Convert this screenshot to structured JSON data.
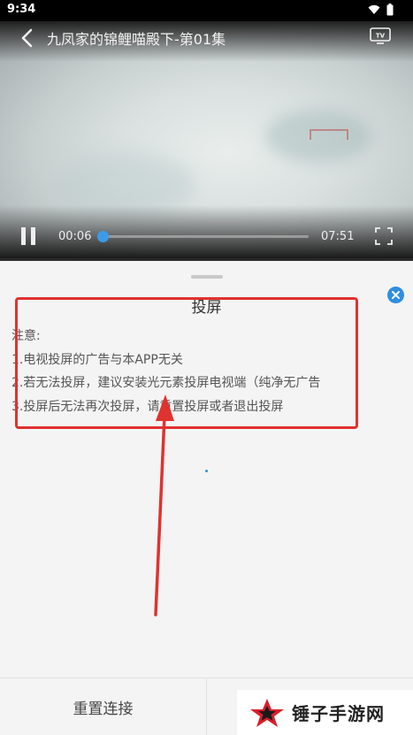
{
  "status_bar": {
    "time": "9:34",
    "icons": [
      "wifi-icon",
      "battery-icon"
    ]
  },
  "player": {
    "title": "九凤家的锦鲤喵殿下-第01集",
    "current_time": "00:06",
    "total_time": "07:51",
    "progress_fraction": 0.013,
    "accent_color": "#3c9be8",
    "icons": [
      "back-icon",
      "tv-cast-icon",
      "pause-icon",
      "fullscreen-icon"
    ]
  },
  "cast_sheet": {
    "title": "投屏",
    "notice_lines": [
      "注意:",
      "1.电视投屏的广告与本APP无关",
      "2.若无法投屏，建议安装光元素投屏电视端（纯净无广告",
      "3.投屏后无法再次投屏，请重置投屏或者退出投屏"
    ],
    "close_color": "#2f8ee0"
  },
  "actions": {
    "reset_label": "重置连接"
  },
  "watermark": {
    "text": "锤子手游网"
  }
}
